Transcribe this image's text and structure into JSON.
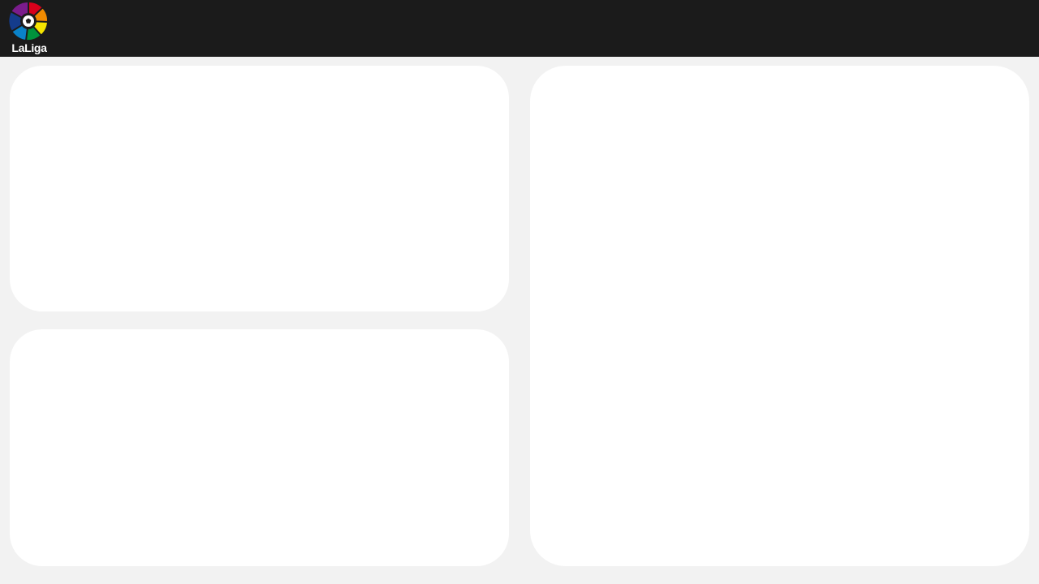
{
  "header": {
    "logo": {
      "text": "LaLiga",
      "icon": "laliga-logo-icon",
      "colors": [
        "#7a1c8c",
        "#d9001b",
        "#f08a00",
        "#f5e400",
        "#00933c",
        "#0a82c8",
        "#143c8c"
      ]
    }
  },
  "colors": {
    "topbar": "#1b1b1b",
    "background": "#f2f2f2",
    "card": "#ffffff"
  },
  "main": {
    "cards": [
      {
        "id": "top-left"
      },
      {
        "id": "bottom-left"
      },
      {
        "id": "right"
      }
    ]
  }
}
